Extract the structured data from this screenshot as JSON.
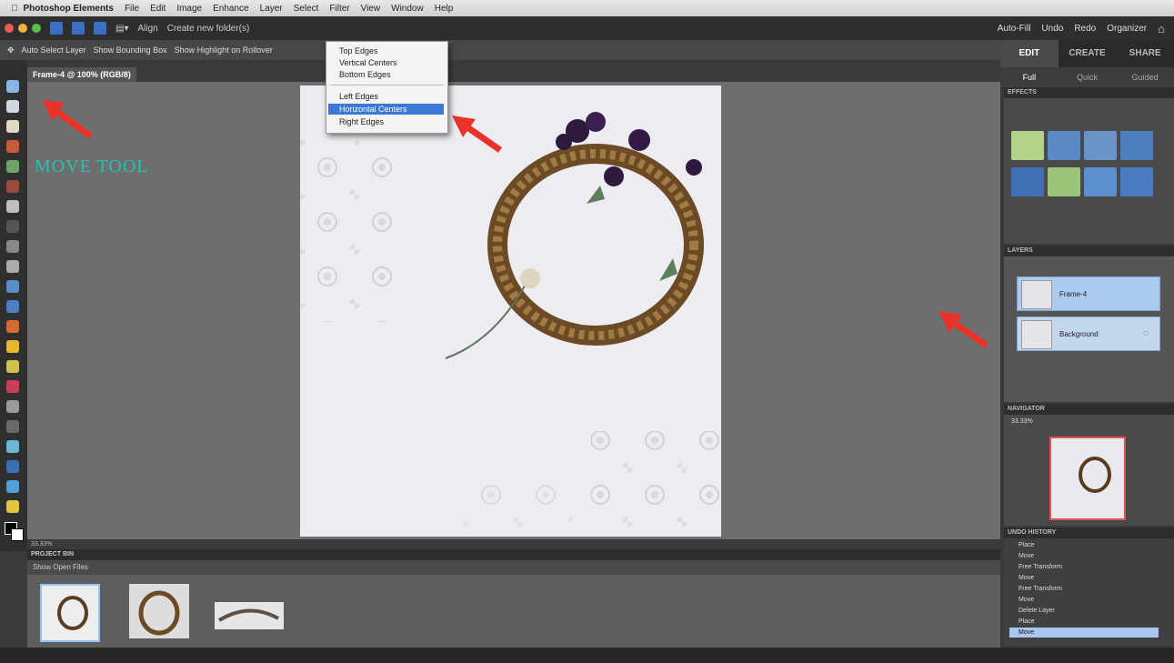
{
  "os_menu": {
    "app_name": "Photoshop Elements",
    "items": [
      "File",
      "Edit",
      "Image",
      "Enhance",
      "Layer",
      "Select",
      "Filter",
      "View",
      "Window",
      "Help"
    ]
  },
  "app_toolbar": {
    "align_label": "Align",
    "create_label": "Create new folder(s)",
    "actions": [
      "Auto-Fill",
      "Undo",
      "Redo",
      "Organizer"
    ]
  },
  "options_bar": {
    "items": [
      "Auto Select Layer",
      "Show Bounding Box",
      "Show Highlight on Rollover"
    ]
  },
  "doc_tab": {
    "active": "Frame-4 @ 100% (RGB/8)"
  },
  "panel_tabs": [
    "EDIT",
    "CREATE",
    "SHARE"
  ],
  "sub_tabs": [
    "Full",
    "Quick",
    "Guided"
  ],
  "annotation": {
    "move_tool": "MOVE TOOL"
  },
  "dropdown": {
    "items": [
      "Top Edges",
      "Vertical Centers",
      "Bottom Edges",
      "Left Edges",
      "Horizontal Centers",
      "Right Edges"
    ],
    "selected_index": 4
  },
  "status_bar": "33.33%",
  "project_bin": {
    "title": "PROJECT BIN",
    "select": "Show Open Files"
  },
  "panels": {
    "effects_title": "EFFECTS",
    "layers_title": "LAYERS",
    "layer_names": [
      "Frame-4",
      "Background"
    ],
    "navigator_title": "NAVIGATOR",
    "navigator_zoom": "33.33%",
    "history_title": "UNDO HISTORY",
    "history": [
      "Place",
      "Move",
      "Free Transform",
      "Move",
      "Free Transform",
      "Move",
      "Delete Layer",
      "Place",
      "Move"
    ],
    "history_selected_index": 8
  },
  "colors": {
    "accent_teal": "#26c2b6",
    "arrow_red": "#e8322a",
    "selection_blue": "#3e78d6"
  }
}
